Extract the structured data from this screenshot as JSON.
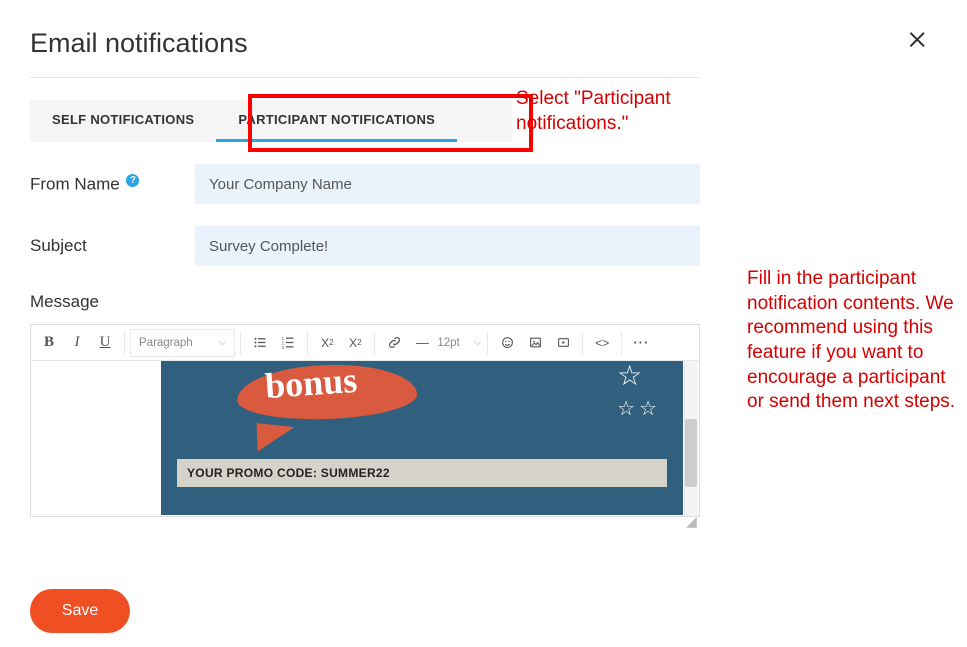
{
  "header": {
    "title": "Email notifications"
  },
  "tabs": {
    "self": "SELF NOTIFICATIONS",
    "participant": "PARTICIPANT NOTIFICATIONS",
    "active": "participant"
  },
  "annotations": {
    "tab_callout": "Select \"Participant notifications.\"",
    "body_callout": "Fill in the participant notification contents. We recommend using this feature if you want to encourage a participant or send them next steps."
  },
  "form": {
    "from_name_label": "From Name",
    "from_name_value": "Your Company Name",
    "subject_label": "Subject",
    "subject_value": "Survey Complete!",
    "message_label": "Message"
  },
  "editor": {
    "block_format": "Paragraph",
    "font_size": "12pt",
    "content": {
      "bubble_text": "bonus",
      "promo_code_line": "YOUR PROMO CODE: SUMMER22"
    }
  },
  "buttons": {
    "save": "Save"
  }
}
